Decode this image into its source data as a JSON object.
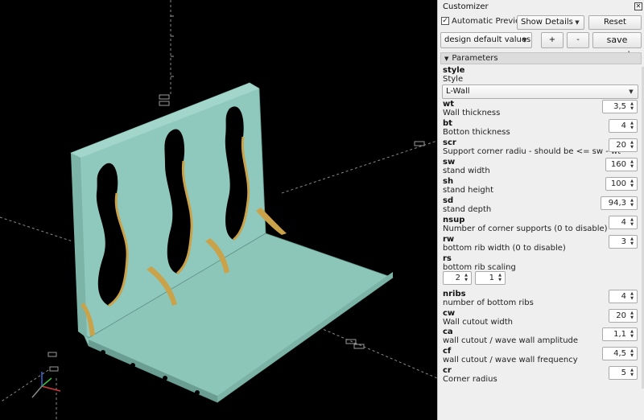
{
  "panel": {
    "title": "Customizer",
    "close_icon": "close-icon",
    "automatic_preview_label": "Automatic Preview",
    "automatic_preview_checked": true,
    "show_details_value": "Show Details",
    "reset_label": "Reset",
    "preset_value": "design default values",
    "add_preset_label": "+",
    "remove_preset_label": "-",
    "save_preset_label": "save preset",
    "parameters_header": "Parameters"
  },
  "params": {
    "style": {
      "name": "style",
      "desc": "Style",
      "value": "L-Wall"
    },
    "wt": {
      "name": "wt",
      "desc": "Wall thickness",
      "value": "3,5"
    },
    "bt": {
      "name": "bt",
      "desc": "Botton thickness",
      "value": "4"
    },
    "scr": {
      "name": "scr",
      "desc": "Support corner radiu - should be <= sw - wt",
      "value": "20"
    },
    "sw": {
      "name": "sw",
      "desc": "stand width",
      "value": "160"
    },
    "sh": {
      "name": "sh",
      "desc": "stand height",
      "value": "100"
    },
    "sd": {
      "name": "sd",
      "desc": "stand depth",
      "value": "94,3"
    },
    "nsup": {
      "name": "nsup",
      "desc": "Number of corner supports (0 to disable)",
      "value": "4"
    },
    "rw": {
      "name": "rw",
      "desc": "bottom rib width (0 to disable)",
      "value": "3"
    },
    "rs": {
      "name": "rs",
      "desc": "bottom rib scaling",
      "value1": "2",
      "value2": "1"
    },
    "nribs": {
      "name": "nribs",
      "desc": "number of bottom ribs",
      "value": "4"
    },
    "cw": {
      "name": "cw",
      "desc": "Wall cutout width",
      "value": "20"
    },
    "ca": {
      "name": "ca",
      "desc": "wall cutout / wave wall amplitude",
      "value": "1,1"
    },
    "cf": {
      "name": "cf",
      "desc": "wall cutout / wave wall frequency",
      "value": "4,5"
    },
    "cr": {
      "name": "cr",
      "desc": "Corner radius",
      "value": "5"
    }
  },
  "colors": {
    "model": "#8fc9bd",
    "model_shadow": "#6fa89c",
    "cutout_edge": "#c9a24a",
    "axis_x": "#d23b3b",
    "axis_y": "#3bbf3b",
    "axis_z": "#3b6bd2",
    "grid": "#9a9a9a"
  }
}
